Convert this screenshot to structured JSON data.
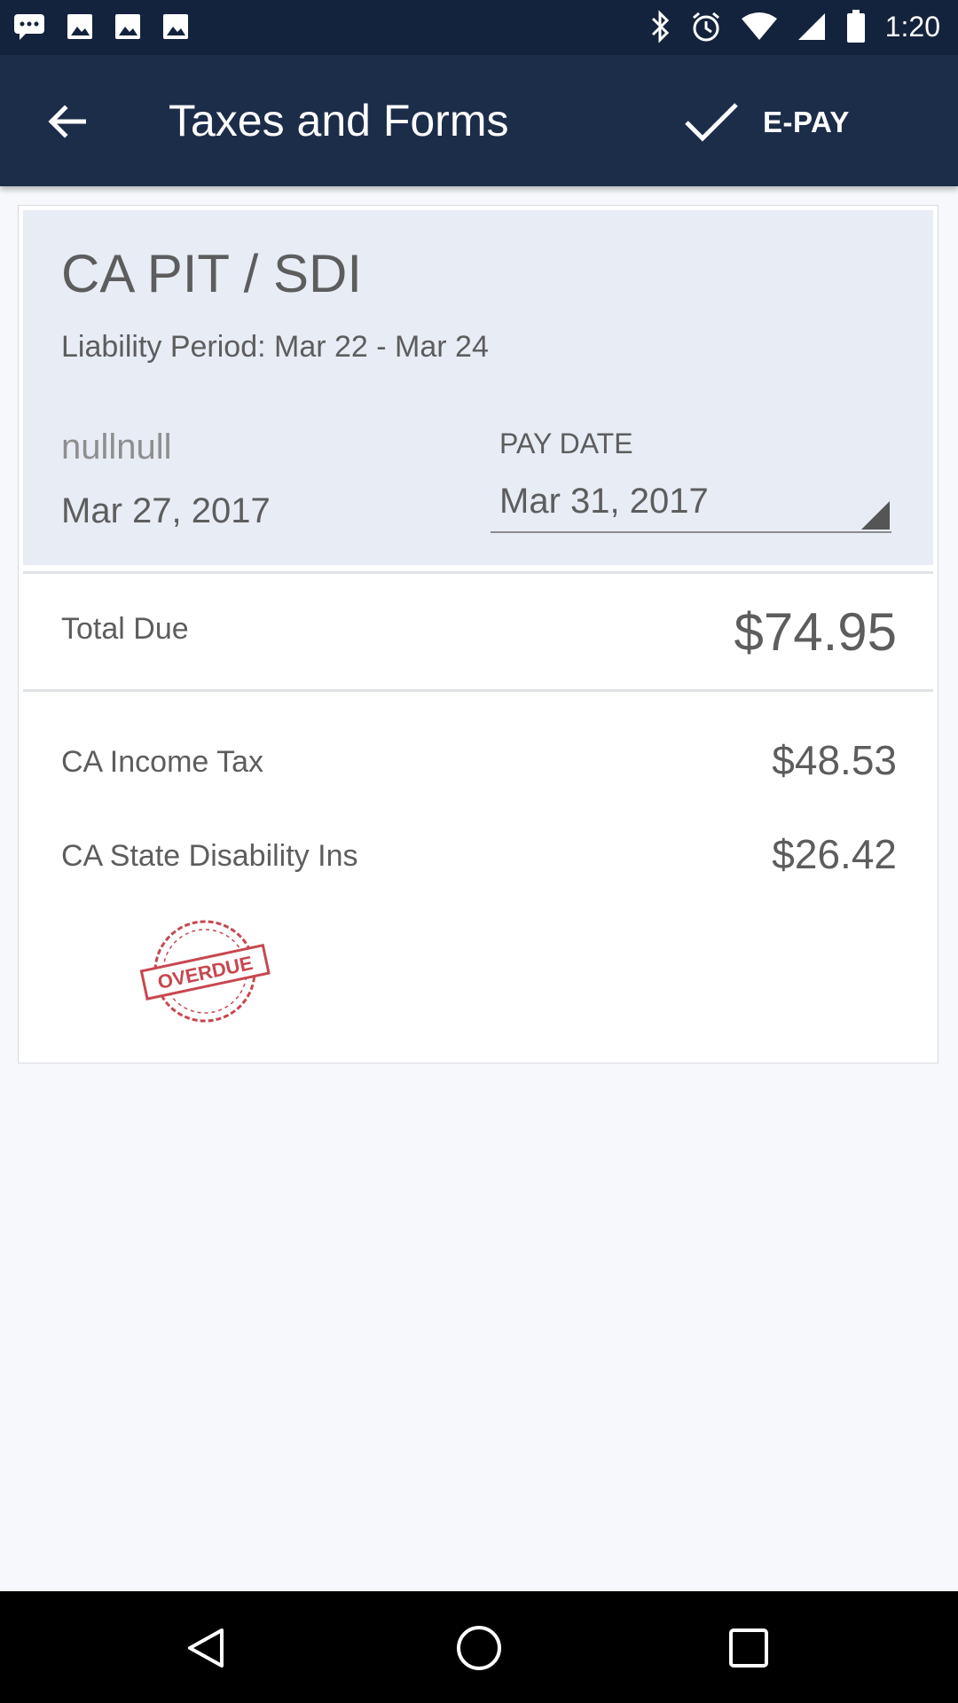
{
  "status_bar": {
    "time": "1:20",
    "icons": [
      "message-icon",
      "image-icon",
      "image-icon",
      "image-icon",
      "bluetooth-icon",
      "alarm-icon",
      "wifi-icon",
      "signal-icon",
      "battery-icon"
    ]
  },
  "app_bar": {
    "back_icon": "arrow-left-icon",
    "title": "Taxes and Forms",
    "epay_icon": "check-icon",
    "epay_label": "E-PAY"
  },
  "tax_card": {
    "name": "CA PIT / SDI",
    "liability_period": "Liability Period: Mar 22 - Mar 24",
    "null_text": "nullnull",
    "created_date": "Mar 27, 2017",
    "pay_date_label": "PAY DATE",
    "pay_date_value": "Mar 31, 2017",
    "total_label": "Total Due",
    "total_amount": "$74.95",
    "items": [
      {
        "label": "CA Income Tax",
        "amount": "$48.53"
      },
      {
        "label": "CA State Disability Ins",
        "amount": "$26.42"
      }
    ],
    "stamp_text": "OVERDUE",
    "stamp_color": "#c8474f"
  },
  "colors": {
    "status_bar": "#14233d",
    "app_bar": "#1c2d4a",
    "card_header": "#e8ecf4",
    "nav_bar": "#000000"
  },
  "nav_bar": {
    "icons": [
      "back-triangle-icon",
      "home-circle-icon",
      "recents-square-icon"
    ]
  }
}
